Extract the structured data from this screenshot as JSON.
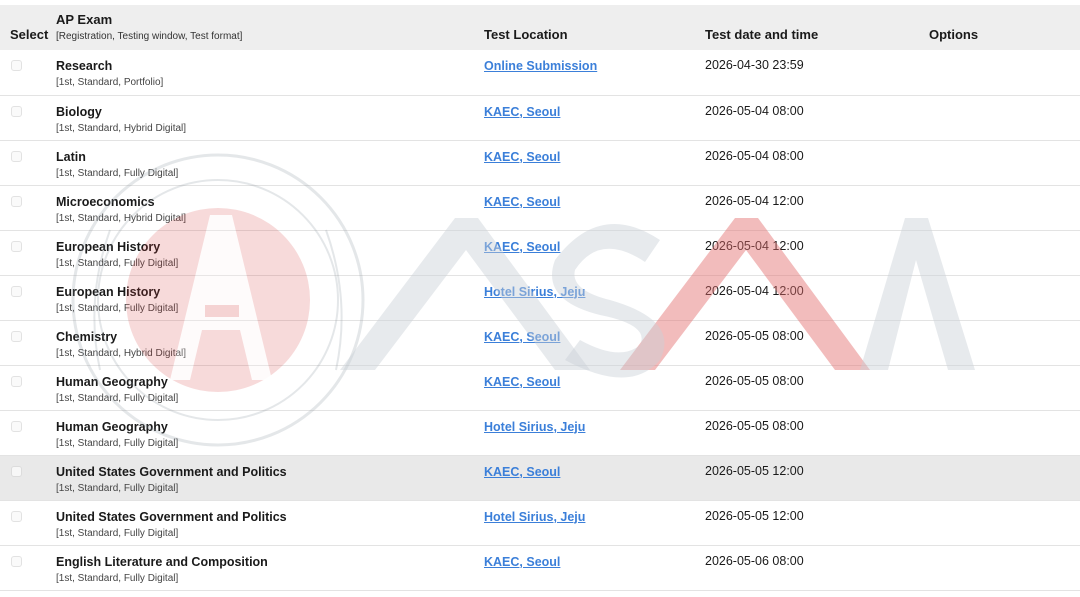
{
  "table": {
    "headers": {
      "select": "Select",
      "exam_title": "AP Exam",
      "exam_sub": "[Registration, Testing window, Test format]",
      "location": "Test Location",
      "datetime": "Test date and time",
      "options": "Options"
    },
    "rows": [
      {
        "name": "Research",
        "meta": "[1st, Standard, Portfolio]",
        "location": "Online Submission",
        "datetime": "2026-04-30 23:59",
        "highlighted": false
      },
      {
        "name": "Biology",
        "meta": "[1st, Standard, Hybrid Digital]",
        "location": "KAEC, Seoul",
        "datetime": "2026-05-04 08:00",
        "highlighted": false
      },
      {
        "name": "Latin",
        "meta": "[1st, Standard, Fully Digital]",
        "location": "KAEC, Seoul",
        "datetime": "2026-05-04 08:00",
        "highlighted": false
      },
      {
        "name": "Microeconomics",
        "meta": "[1st, Standard, Hybrid Digital]",
        "location": "KAEC, Seoul",
        "datetime": "2026-05-04 12:00",
        "highlighted": false
      },
      {
        "name": "European History",
        "meta": "[1st, Standard, Fully Digital]",
        "location": "KAEC, Seoul",
        "datetime": "2026-05-04 12:00",
        "highlighted": false
      },
      {
        "name": "European History",
        "meta": "[1st, Standard, Fully Digital]",
        "location": "Hotel Sirius, Jeju",
        "datetime": "2026-05-04 12:00",
        "highlighted": false
      },
      {
        "name": "Chemistry",
        "meta": "[1st, Standard, Hybrid Digital]",
        "location": "KAEC, Seoul",
        "datetime": "2026-05-05 08:00",
        "highlighted": false
      },
      {
        "name": "Human Geography",
        "meta": "[1st, Standard, Fully Digital]",
        "location": "KAEC, Seoul",
        "datetime": "2026-05-05 08:00",
        "highlighted": false
      },
      {
        "name": "Human Geography",
        "meta": "[1st, Standard, Fully Digital]",
        "location": "Hotel Sirius, Jeju",
        "datetime": "2026-05-05 08:00",
        "highlighted": false
      },
      {
        "name": "United States Government and Politics",
        "meta": "[1st, Standard, Fully Digital]",
        "location": "KAEC, Seoul",
        "datetime": "2026-05-05 12:00",
        "highlighted": true
      },
      {
        "name": "United States Government and Politics",
        "meta": "[1st, Standard, Fully Digital]",
        "location": "Hotel Sirius, Jeju",
        "datetime": "2026-05-05 12:00",
        "highlighted": false
      },
      {
        "name": "English Literature and Composition",
        "meta": "[1st, Standard, Fully Digital]",
        "location": "KAEC, Seoul",
        "datetime": "2026-05-06 08:00",
        "highlighted": false
      }
    ]
  },
  "watermark": {
    "text": "ASAA",
    "seal_text": "ASAA",
    "color_gray": "#c9d0d8",
    "color_red": "#e26a6a"
  },
  "colors": {
    "link": "#3b7fd9",
    "header_bg": "#eeeeee",
    "highlight_row": "#e9e9e9"
  }
}
